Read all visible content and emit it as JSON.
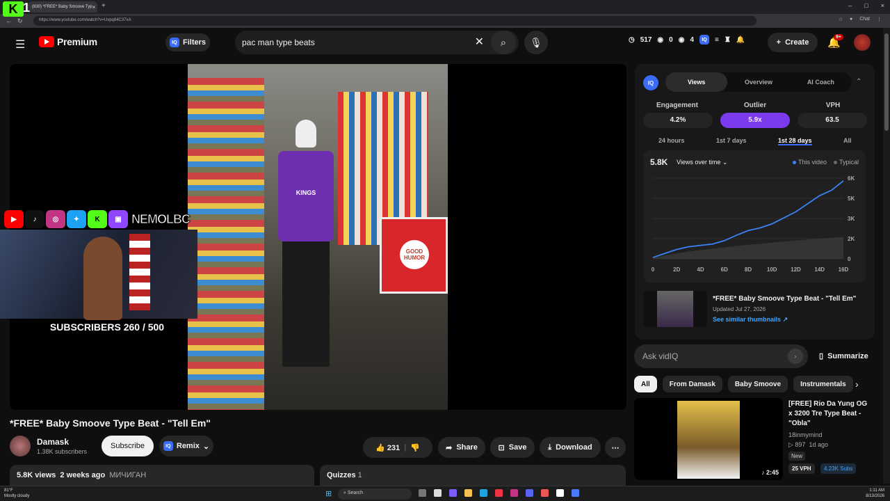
{
  "browser": {
    "tab_title": "(830) *FREE* Baby Smoove Typ",
    "url": "https://www.youtube.com/watch?v=Uvpq84C37xA",
    "chat_label": "Chat"
  },
  "stream_overlay": {
    "logo_letter": "K",
    "logo_number": "1",
    "handle": "NEMOLBC",
    "subscriber_counter": "SUBSCRIBERS 260 / 500",
    "socials": [
      "youtube",
      "tiktok",
      "instagram",
      "twitter",
      "kick",
      "twitch"
    ]
  },
  "header": {
    "brand": "Premium",
    "filters_label": "Filters",
    "search_value": "pac man type beats",
    "stats": {
      "a": "517",
      "b": "0",
      "c": "4"
    },
    "create_label": "Create",
    "notif_badge": "9+"
  },
  "video": {
    "title": "*FREE* Baby Smoove Type Beat - \"Tell Em\"",
    "channel": "Damask",
    "channel_subs": "1.38K subscribers",
    "subscribe_label": "Subscribe",
    "remix_label": "Remix",
    "likes": "231",
    "share_label": "Share",
    "save_label": "Save",
    "download_label": "Download",
    "views": "5.8K views",
    "age": "2 weeks ago",
    "location": "МИЧИГАН",
    "quizzes_label": "Quizzes",
    "quizzes_count": "1",
    "frame_text": {
      "cooler": "GOOD HUMOR",
      "jersey": "KINGS"
    }
  },
  "vidiq": {
    "tabs": [
      "Views",
      "Overview",
      "AI Coach"
    ],
    "metrics": [
      {
        "label": "Engagement",
        "value": "4.2%"
      },
      {
        "label": "Outlier",
        "value": "5.9x"
      },
      {
        "label": "VPH",
        "value": "63.5"
      }
    ],
    "ranges": [
      "24 hours",
      "1st 7 days",
      "1st 28 days",
      "All"
    ],
    "total": "5.8K",
    "dropdown": "Views over time",
    "legend_this": "This video",
    "legend_typical": "Typical",
    "video_title": "*FREE* Baby Smoove Type Beat - \"Tell Em\"",
    "updated": "Updated Jul 27, 2026",
    "similar_link": "See similar thumbnails",
    "ask_placeholder": "Ask vidIQ",
    "summarize_label": "Summarize"
  },
  "chart_data": {
    "type": "area",
    "x": [
      0,
      1,
      2,
      3,
      4,
      5,
      6,
      7,
      8,
      9,
      10,
      11,
      12,
      13,
      14,
      15,
      16
    ],
    "x_tick_labels": [
      "0",
      "2D",
      "4D",
      "6D",
      "8D",
      "10D",
      "12D",
      "14D",
      "16D"
    ],
    "y_tick_labels": [
      "0",
      "2K",
      "3K",
      "5K",
      "6K"
    ],
    "ylim": [
      0,
      6
    ],
    "series": [
      {
        "name": "This video",
        "color": "#3b82f6",
        "values": [
          0.1,
          0.4,
          0.7,
          0.9,
          1.0,
          1.1,
          1.35,
          1.75,
          2.1,
          2.3,
          2.6,
          3.05,
          3.5,
          4.1,
          4.7,
          5.1,
          5.8
        ]
      },
      {
        "name": "Typical",
        "color": "#6b6b6b",
        "values": [
          0.05,
          0.25,
          0.4,
          0.55,
          0.65,
          0.75,
          0.85,
          0.95,
          1.05,
          1.12,
          1.2,
          1.28,
          1.36,
          1.44,
          1.5,
          1.56,
          1.62
        ]
      }
    ]
  },
  "chips": [
    "All",
    "From Damask",
    "Baby Smoove",
    "Instrumentals"
  ],
  "recommendation": {
    "title": "[FREE] Rio Da Yung OG x 3200 Tre Type Beat - \"Obla\"",
    "channel": "18inmymind",
    "views": "897",
    "age": "1d ago",
    "new_label": "New",
    "vph": "25 VPH",
    "subs": "4.23K Subs",
    "duration": "2:45"
  },
  "taskbar": {
    "temp": "81°F",
    "weather": "Mostly cloudy",
    "search": "Search",
    "time": "1:11 AM",
    "date": "8/13/2026"
  }
}
